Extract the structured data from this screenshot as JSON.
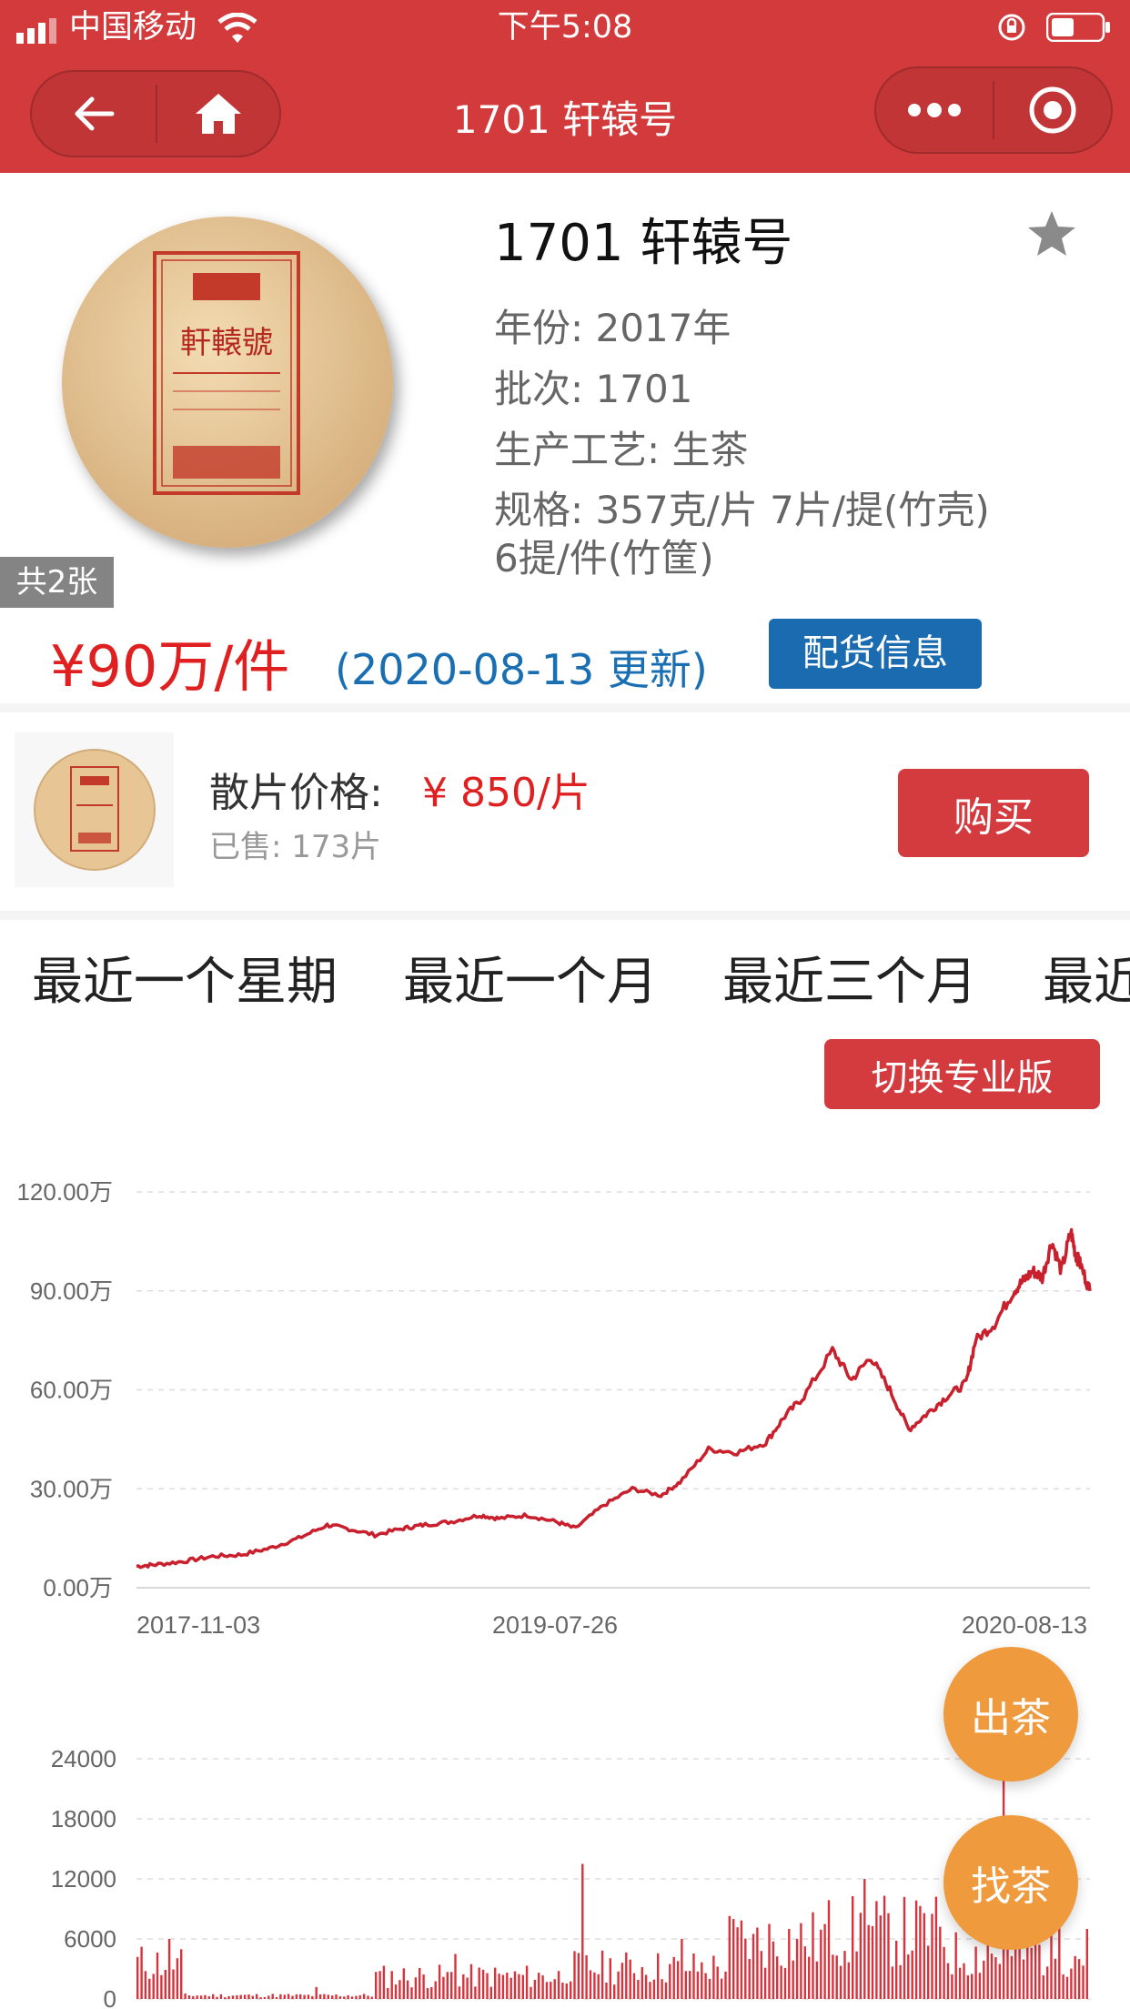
{
  "status_bar": {
    "carrier": "中国移动",
    "time": "下午5:08"
  },
  "nav": {
    "title": "1701 轩辕号"
  },
  "product": {
    "name": "1701 轩辕号",
    "image_count": "共2张",
    "year": "年份: 2017年",
    "batch": "批次: 1701",
    "process": "生产工艺: 生茶",
    "spec_line1": "规格: 357克/片 7片/提(竹壳)",
    "spec_line2": "6提/件(竹筐)",
    "price": "¥90万/件",
    "updated": "(2020-08-13 更新)",
    "supply_button": "配货信息",
    "cake_text": "軒轅號"
  },
  "loose": {
    "label": "散片价格:",
    "price": "¥ 850/片",
    "sold": "已售: 173片",
    "buy_button": "购买"
  },
  "tabs": [
    "最近一个星期",
    "最近一个月",
    "最近三个月",
    "最近"
  ],
  "switch_button": "切换专业版",
  "fab": {
    "sell": "出茶",
    "find": "找茶"
  },
  "colors": {
    "brand_red": "#d23a3c",
    "price_red": "#e02020",
    "blue": "#1a6fb3",
    "orange": "#f09a3e"
  },
  "chart_data": [
    {
      "type": "line",
      "y_ticks": [
        "120.00万",
        "90.00万",
        "60.00万",
        "30.00万",
        "0.00万"
      ],
      "x_ticks": [
        "2017-11-03",
        "2019-07-26",
        "2020-08-13"
      ],
      "ylim": [
        0,
        120
      ],
      "x": [
        0,
        0.02,
        0.05,
        0.08,
        0.11,
        0.14,
        0.17,
        0.2,
        0.22,
        0.25,
        0.28,
        0.3,
        0.33,
        0.36,
        0.38,
        0.41,
        0.44,
        0.46,
        0.49,
        0.52,
        0.55,
        0.57,
        0.6,
        0.63,
        0.66,
        0.68,
        0.7,
        0.73,
        0.75,
        0.77,
        0.79,
        0.81,
        0.83,
        0.85,
        0.87,
        0.88,
        0.9,
        0.92,
        0.93,
        0.94,
        0.95,
        0.96,
        0.97,
        0.98,
        0.985,
        0.99,
        1.0
      ],
      "values": [
        6.5,
        7,
        8,
        9.5,
        10,
        12,
        15,
        19,
        18,
        16,
        18,
        19,
        20,
        22,
        21,
        22,
        20,
        18,
        25,
        30,
        28,
        32,
        42,
        41,
        44,
        52,
        58,
        72,
        63,
        70,
        60,
        48,
        53,
        58,
        62,
        75,
        80,
        90,
        93,
        96,
        94,
        105,
        96,
        108,
        101,
        98,
        90
      ],
      "grid": true
    },
    {
      "type": "bar",
      "y_ticks": [
        "24000",
        "18000",
        "12000",
        "6000",
        "0"
      ],
      "ylim": [
        0,
        24000
      ],
      "grid": true
    }
  ]
}
